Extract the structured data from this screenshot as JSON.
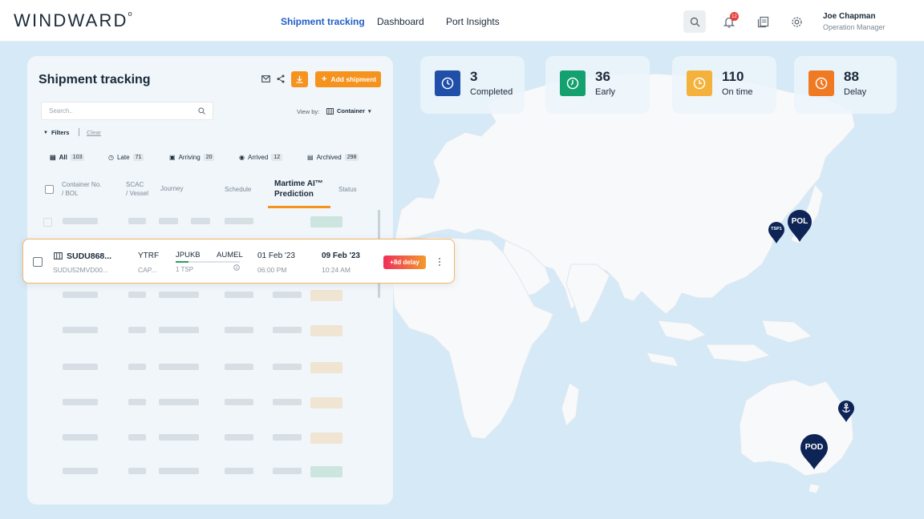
{
  "header": {
    "logo": "WINDWARD",
    "logo_mark": "o",
    "nav": [
      "Shipment tracking",
      "Dashboard",
      "Port Insights"
    ],
    "notification_count": "12",
    "user_name": "Joe Chapman",
    "user_role": "Operation Manager"
  },
  "panel": {
    "title": "Shipment tracking",
    "add_label": "Add shipment",
    "search_placeholder": "Search..",
    "view_by_label": "View by:",
    "view_by_value": "Container",
    "filters_label": "Filters",
    "clear_label": "Clear",
    "tabs": [
      {
        "label": "All",
        "count": "103"
      },
      {
        "label": "Late",
        "count": "71"
      },
      {
        "label": "Arriving",
        "count": "20"
      },
      {
        "label": "Arrived",
        "count": "12"
      },
      {
        "label": "Archived",
        "count": "298"
      }
    ],
    "columns": {
      "container_1": "Container No.",
      "container_2": "/ BOL",
      "scac_1": "SCAC",
      "scac_2": "/ Vessel",
      "journey": "Journey",
      "schedule": "Schedule",
      "ai_1": "Martime AI™",
      "ai_2": "Prediction",
      "status": "Status"
    }
  },
  "row": {
    "container": "SUDU868...",
    "bol": "SUDU52MVD00...",
    "scac": "YTRF",
    "vessel": "CAP...",
    "from": "JPUKB",
    "to": "AUMEL",
    "progress": 0.2,
    "tsp": "1 TSP",
    "schedule_date": "01 Feb '23",
    "schedule_time": "06:00 PM",
    "prediction_date": "09 Feb '23",
    "prediction_time": "10:24 AM",
    "status": "+8d delay"
  },
  "stats": [
    {
      "value": "3",
      "label": "Completed",
      "color": "#1f4fa8",
      "icon": "clock-icon"
    },
    {
      "value": "36",
      "label": "Early",
      "color": "#14a06f",
      "icon": "clock-icon"
    },
    {
      "value": "110",
      "label": "On time",
      "color": "#f4b23c",
      "icon": "clock-icon"
    },
    {
      "value": "88",
      "label": "Delay",
      "color": "#f07a22",
      "icon": "clock-icon"
    }
  ],
  "map": {
    "pins": [
      {
        "name": "pol-pin",
        "label": "POL"
      },
      {
        "name": "tsp-pin",
        "label": "TSP1"
      },
      {
        "name": "pod-pin",
        "label": "POD"
      },
      {
        "name": "anchor-pin",
        "label": ""
      }
    ]
  },
  "colors": {
    "accent": "#f6931e",
    "brand_blue": "#1f5ec7",
    "pin_navy": "#0f2456",
    "map_water": "#d6e9f6",
    "map_land": "#f7f9fb"
  }
}
